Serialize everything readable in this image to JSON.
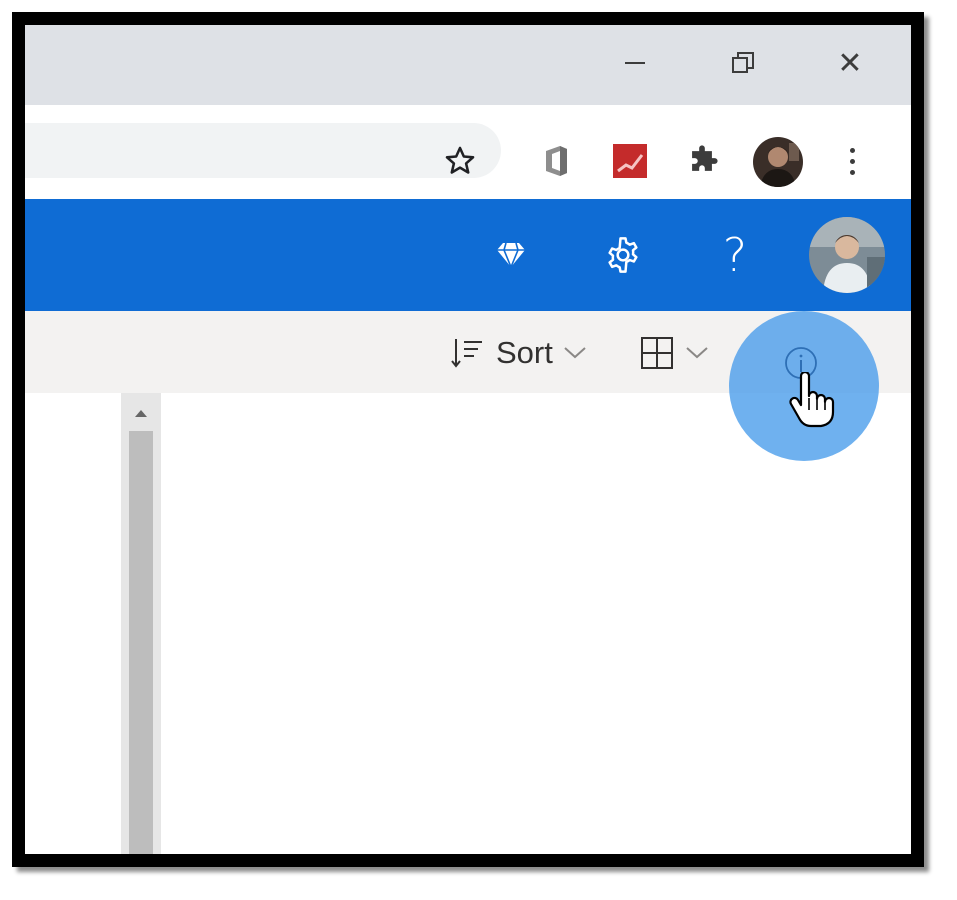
{
  "browser": {
    "window_controls": {
      "minimize_icon": "minimize-icon",
      "restore_icon": "restore-icon",
      "close_icon": "close-icon",
      "close_glyph": "✕"
    },
    "toolbar": {
      "bookmark_icon": "star-icon",
      "extensions": [
        "office-icon",
        "red-extension-icon",
        "puzzle-icon"
      ],
      "menu_icon": "kebab-menu-icon"
    }
  },
  "outlook": {
    "header": {
      "icons": [
        "diamond-icon",
        "gear-icon",
        "help-icon"
      ],
      "help_glyph": "?",
      "brand_color": "#0f6cd4"
    },
    "commandbar": {
      "sort_label": "Sort",
      "view_icon": "grid-icon"
    }
  },
  "highlight": {
    "color": "#5aa6ec",
    "target_icon": "info-icon",
    "cursor": "hand-pointer-icon"
  }
}
